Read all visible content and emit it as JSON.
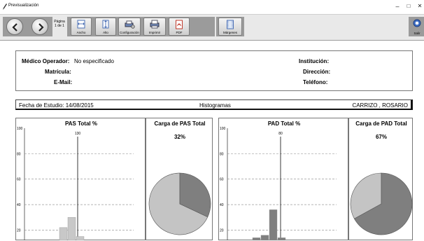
{
  "window": {
    "title": "Previsualización",
    "minimize_glyph": "–",
    "maximize_glyph": "□",
    "close_glyph": "✕"
  },
  "toolbar": {
    "back_icon": "arrow-left-icon",
    "forward_icon": "arrow-right-icon",
    "page_label": "Página",
    "page_value": "1 de 1",
    "buttons": [
      {
        "label": "Ancho",
        "icon": "fit-width-icon"
      },
      {
        "label": "Alto",
        "icon": "fit-height-icon"
      },
      {
        "label": "Configuración",
        "icon": "printer-setup-icon"
      },
      {
        "label": "Imprimir",
        "icon": "printer-icon"
      },
      {
        "label": "PDF",
        "icon": "pdf-icon"
      },
      {
        "label": "Márgenes",
        "icon": "margins-icon"
      },
      {
        "label": "Salir",
        "icon": "exit-icon"
      }
    ]
  },
  "report": {
    "medico_label": "Médico Operador:",
    "medico_value": "No especificado",
    "matricula_label": "Matrícula:",
    "matricula_value": "",
    "email_label": "E-Mail:",
    "email_value": "",
    "institucion_label": "Institución:",
    "institucion_value": "",
    "direccion_label": "Dirección:",
    "direccion_value": "",
    "telefono_label": "Teléfono:",
    "telefono_value": "",
    "fecha_estudio": "Fecha de Estudio: 14/08/2015",
    "section_title": "Histogramas",
    "patient_name": "CARRIZO , ROSARIO"
  },
  "chart_data": [
    {
      "type": "bar",
      "title": "PAS Total %",
      "yticks": [
        100,
        80,
        60,
        40,
        20
      ],
      "ylim": [
        12,
        100
      ],
      "threshold_label": "130",
      "bars": [
        12,
        22,
        30,
        15
      ],
      "bar_color": "#c8c8c8",
      "grid": true
    },
    {
      "type": "pie",
      "title": "Carga de PAS Total",
      "value_label": "32%",
      "value": 32,
      "colors": {
        "load": "#7f7f7f",
        "rest": "#c4c4c4"
      }
    },
    {
      "type": "bar",
      "title": "PAD Total %",
      "yticks": [
        100,
        80,
        60,
        40,
        20
      ],
      "ylim": [
        12,
        100
      ],
      "threshold_label": "80",
      "bars": [
        14,
        16,
        36,
        14
      ],
      "bar_color": "#7f7f7f",
      "grid": true
    },
    {
      "type": "pie",
      "title": "Carga de PAD Total",
      "value_label": "67%",
      "value": 67,
      "colors": {
        "load": "#7f7f7f",
        "rest": "#c4c4c4"
      }
    }
  ]
}
